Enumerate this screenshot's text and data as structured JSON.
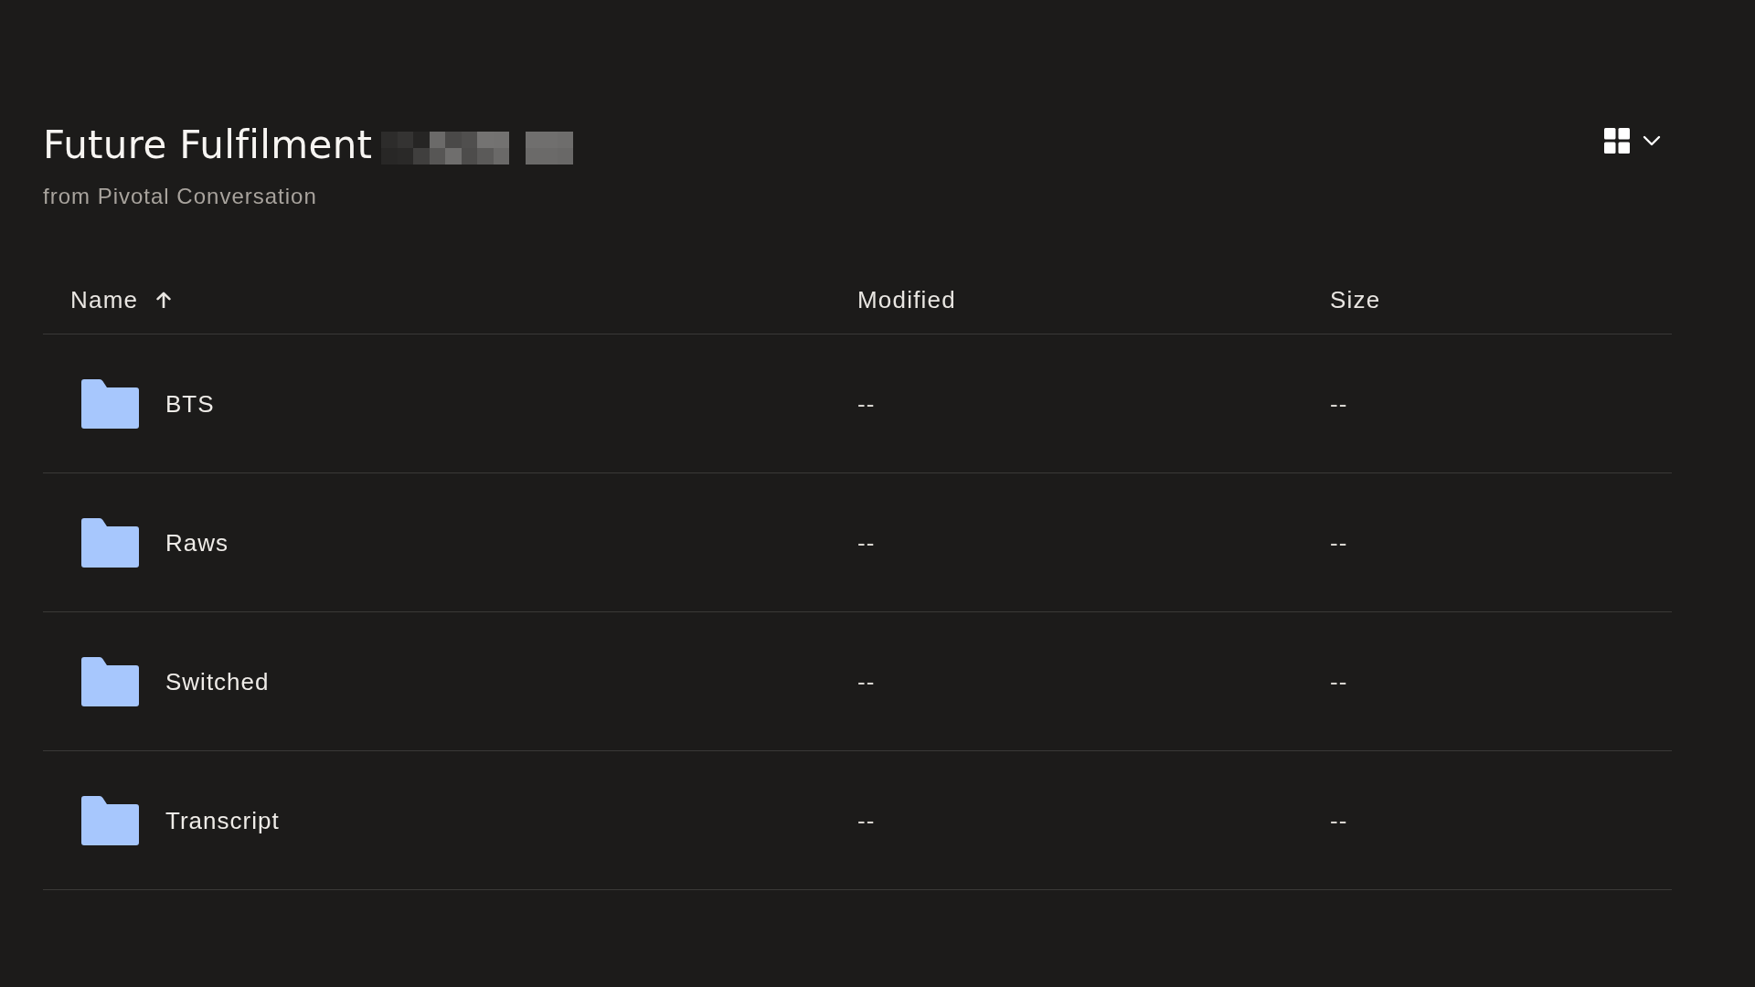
{
  "folder": {
    "title": "Future Fulfilment",
    "subtitle": "from Pivotal Conversation"
  },
  "table": {
    "columns": [
      {
        "label": "Name",
        "sorted_ascending": true
      },
      {
        "label": "Modified",
        "sorted_ascending": false
      },
      {
        "label": "Size",
        "sorted_ascending": false
      }
    ],
    "rows": [
      {
        "kind": "folder",
        "name": "BTS",
        "modified": "--",
        "size": "--"
      },
      {
        "kind": "folder",
        "name": "Raws",
        "modified": "--",
        "size": "--"
      },
      {
        "kind": "folder",
        "name": "Switched",
        "modified": "--",
        "size": "--"
      },
      {
        "kind": "folder",
        "name": "Transcript",
        "modified": "--",
        "size": "--"
      }
    ]
  }
}
